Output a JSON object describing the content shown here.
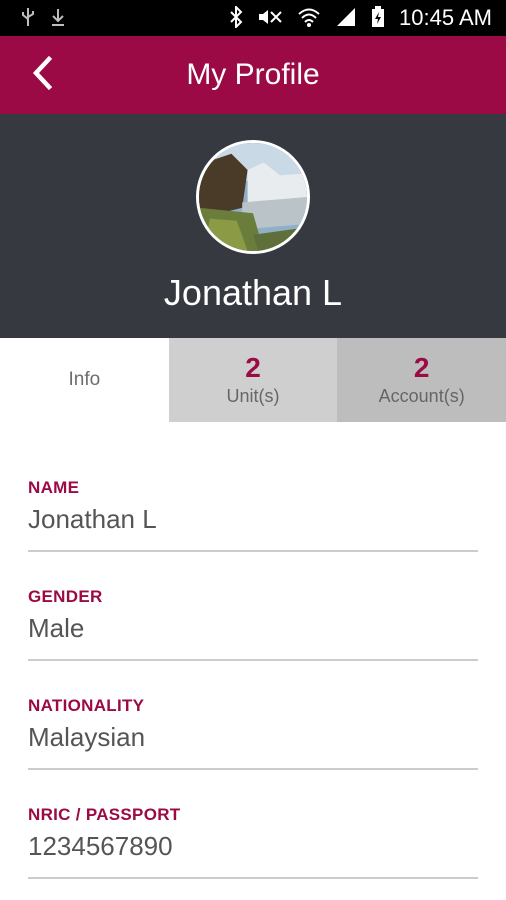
{
  "status_bar": {
    "time": "10:45 AM",
    "left_icons": [
      "usb-icon",
      "download-icon"
    ],
    "right_icons": [
      "bluetooth-icon",
      "mute-icon",
      "wifi-icon",
      "signal-icon",
      "battery-icon"
    ]
  },
  "app_bar": {
    "title": "My Profile",
    "back_icon": "chevron-left-icon",
    "color": "#9b0a45"
  },
  "profile": {
    "name": "Jonathan L",
    "avatar_icon": "waterfall-photo"
  },
  "tabs": [
    {
      "label": "Info",
      "selected": true
    },
    {
      "count": "2",
      "label": "Unit(s)"
    },
    {
      "count": "2",
      "label": "Account(s)"
    }
  ],
  "fields": [
    {
      "label": "NAME",
      "value": "Jonathan L"
    },
    {
      "label": "GENDER",
      "value": "Male"
    },
    {
      "label": "NATIONALITY",
      "value": "Malaysian"
    },
    {
      "label": "NRIC / PASSPORT",
      "value": "1234567890"
    }
  ]
}
